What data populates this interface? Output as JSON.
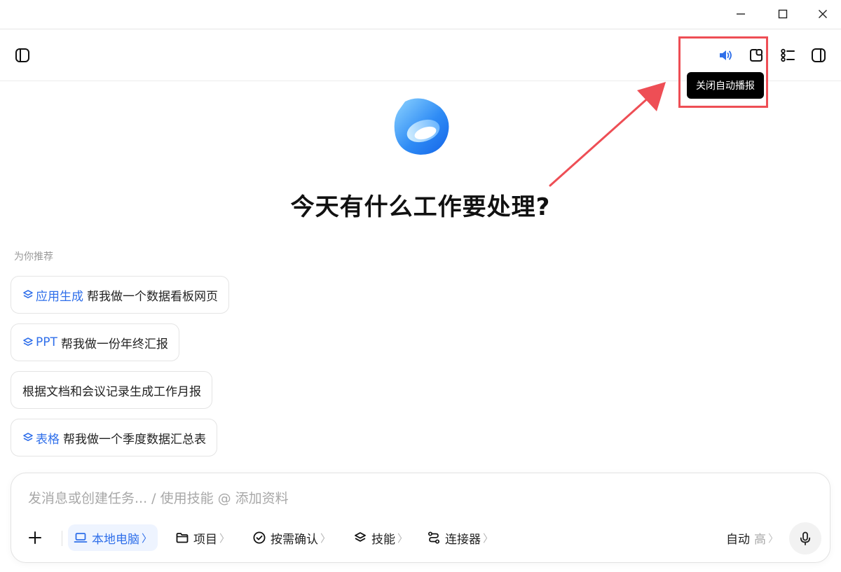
{
  "window": {
    "controls": [
      "minimize-icon",
      "maximize-icon",
      "close-icon"
    ]
  },
  "toolbar": {
    "icons": [
      "sidebar-toggle-icon",
      "speaker-icon",
      "new-chat-icon",
      "task-list-icon",
      "panel-toggle-icon"
    ],
    "tooltip": "关闭自动播报",
    "accent": "#2f6fea",
    "highlight_color": "#ee4e55"
  },
  "hero": {
    "headline": "今天有什么工作要处理?"
  },
  "recommend": {
    "label": "为你推荐",
    "items": [
      {
        "tag": "应用生成",
        "text": "帮我做一个数据看板网页"
      },
      {
        "tag": "PPT",
        "text": "帮我做一份年终汇报"
      },
      {
        "tag": "",
        "text": "根据文档和会议记录生成工作月报"
      },
      {
        "tag": "表格",
        "text": "帮我做一个季度数据汇总表"
      }
    ]
  },
  "composer": {
    "placeholder": "发消息或创建任务... / 使用技能 @ 添加资料",
    "buttons": {
      "local": "本地电脑",
      "project": "项目",
      "confirm": "按需确认",
      "skills": "技能",
      "connector": "连接器"
    },
    "mode": "自动",
    "level": "高",
    "chevron": "〉"
  }
}
